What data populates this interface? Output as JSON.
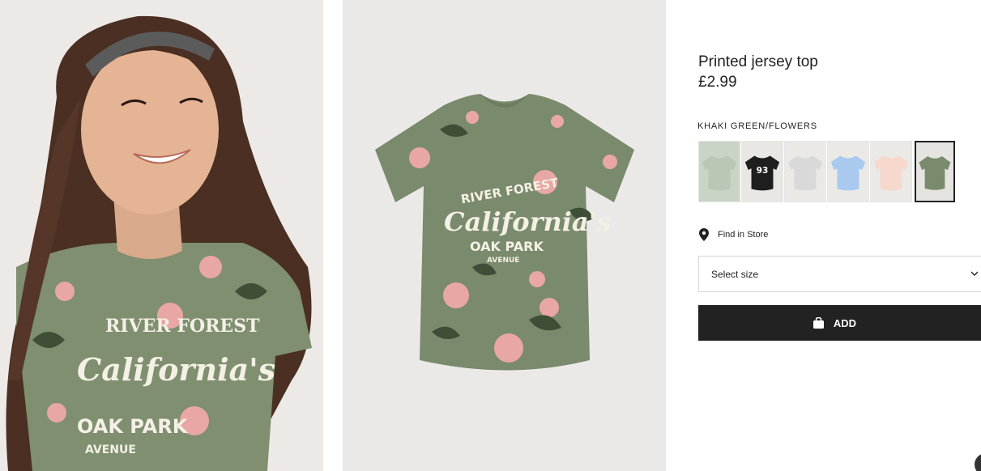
{
  "product": {
    "title": "Printed jersey top",
    "price": "£2.99"
  },
  "images": {
    "model_photo": "model-photo",
    "flat_photo": "product-flatlay-photo",
    "print_text": {
      "line1": "RIVER FOREST",
      "line2": "California's",
      "line3": "OAK PARK",
      "line4": "AVENUE"
    }
  },
  "color": {
    "selected_name": "KHAKI GREEN/FLOWERS",
    "swatches": [
      {
        "name": "swatch-floral-multicolor",
        "bg": "#c9d3c6",
        "shirt": "#b8c8b4",
        "print": "",
        "selected": false
      },
      {
        "name": "swatch-black-93",
        "bg": "#e9e7e4",
        "shirt": "#1e1e1e",
        "print": "93",
        "selected": false
      },
      {
        "name": "swatch-light-grey",
        "bg": "#ebe9e6",
        "shirt": "#d9d9d9",
        "print": "",
        "selected": false
      },
      {
        "name": "swatch-light-blue",
        "bg": "#ebe9e6",
        "shirt": "#a9c9ef",
        "print": "",
        "selected": false
      },
      {
        "name": "swatch-light-pink",
        "bg": "#ebe9e6",
        "shirt": "#f7d8cc",
        "print": "",
        "selected": false
      },
      {
        "name": "swatch-khaki-green-flowers",
        "bg": "#e6e4e1",
        "shirt": "#7a8a6c",
        "print": "",
        "selected": true
      }
    ]
  },
  "store": {
    "find_label": "Find in Store",
    "icon": "location-pin-icon"
  },
  "size": {
    "placeholder": "Select size",
    "icon": "chevron-down-icon"
  },
  "cart": {
    "add_label": "ADD",
    "icon": "shopping-bag-icon"
  },
  "colors": {
    "button_bg": "#222222",
    "shirt_khaki": "#7a8a6c",
    "flower_pink": "#e8a7a4",
    "leaf_dark": "#3f4f37"
  }
}
